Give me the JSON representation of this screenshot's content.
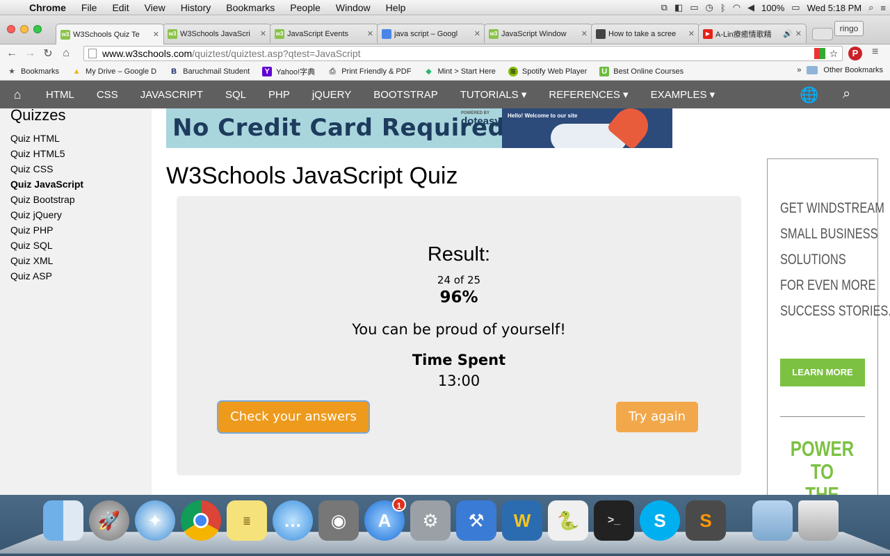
{
  "menubar": {
    "app": "Chrome",
    "items": [
      "File",
      "Edit",
      "View",
      "History",
      "Bookmarks",
      "People",
      "Window",
      "Help"
    ],
    "battery": "100%",
    "clock": "Wed 5:18 PM"
  },
  "tabs": [
    {
      "label": "W3Schools Quiz Te",
      "active": true
    },
    {
      "label": "W3Schools JavaScri"
    },
    {
      "label": "JavaScript Events"
    },
    {
      "label": "java script – Googl"
    },
    {
      "label": "JavaScript Window"
    },
    {
      "label": "How to take a scree"
    },
    {
      "label": "A-Lin療癒情歌精"
    }
  ],
  "profile": "ringo",
  "url": {
    "host": "www.w3schools.com",
    "path": "/quiztest/quiztest.asp?qtest=JavaScript"
  },
  "bookmarks": {
    "items": [
      "Bookmarks",
      "My Drive – Google D",
      "Baruchmail Student",
      "Yahoo!字典",
      "Print Friendly & PDF",
      "Mint > Start Here",
      "Spotify Web Player",
      "Best Online Courses"
    ],
    "overflow": "»",
    "other": "Other Bookmarks"
  },
  "w3nav": {
    "items": [
      "HTML",
      "CSS",
      "JAVASCRIPT",
      "SQL",
      "PHP",
      "jQUERY",
      "BOOTSTRAP",
      "TUTORIALS ▾",
      "REFERENCES ▾",
      "EXAMPLES ▾"
    ]
  },
  "sidebar": {
    "heading": "Quizzes",
    "items": [
      "Quiz HTML",
      "Quiz HTML5",
      "Quiz CSS",
      "Quiz JavaScript",
      "Quiz Bootstrap",
      "Quiz jQuery",
      "Quiz PHP",
      "Quiz SQL",
      "Quiz XML",
      "Quiz ASP"
    ],
    "current_index": 3
  },
  "banner": {
    "tagline": "No Credit Card Required",
    "brand": "doteasy",
    "powered": "POWERED BY",
    "hello": "Hello! Welcome to our site"
  },
  "page": {
    "title": "W3Schools JavaScript Quiz"
  },
  "result": {
    "label": "Result:",
    "score": "24 of 25",
    "percent": "96%",
    "message": "You can be proud of yourself!",
    "time_label": "Time Spent",
    "time_value": "13:00",
    "check_button": "Check your answers",
    "again_button": "Try again"
  },
  "side_ad": {
    "lines": [
      "GET WINDSTREAM",
      "SMALL BUSINESS",
      "SOLUTIONS",
      "FOR EVEN MORE",
      "SUCCESS STORIES."
    ],
    "button": "LEARN MORE",
    "slogan_1": "POWER TO",
    "slogan_2": "THE SMALL."
  },
  "dock": {
    "app_store_badge": "1",
    "icons": [
      "finder-icon",
      "launchpad-icon",
      "safari-icon",
      "chrome-icon",
      "stickies-icon",
      "messages-icon",
      "facetime-icon",
      "app-store-icon",
      "system-preferences-icon",
      "xcode-icon",
      "wunderlist-icon",
      "python-icon",
      "terminal-icon",
      "skype-icon",
      "sublime-icon",
      "folder-icon",
      "trash-icon"
    ]
  },
  "colors": {
    "w3nav_bg": "#5f5f5f",
    "button_orange": "#ee9a1c",
    "ad_green": "#7cc142"
  }
}
